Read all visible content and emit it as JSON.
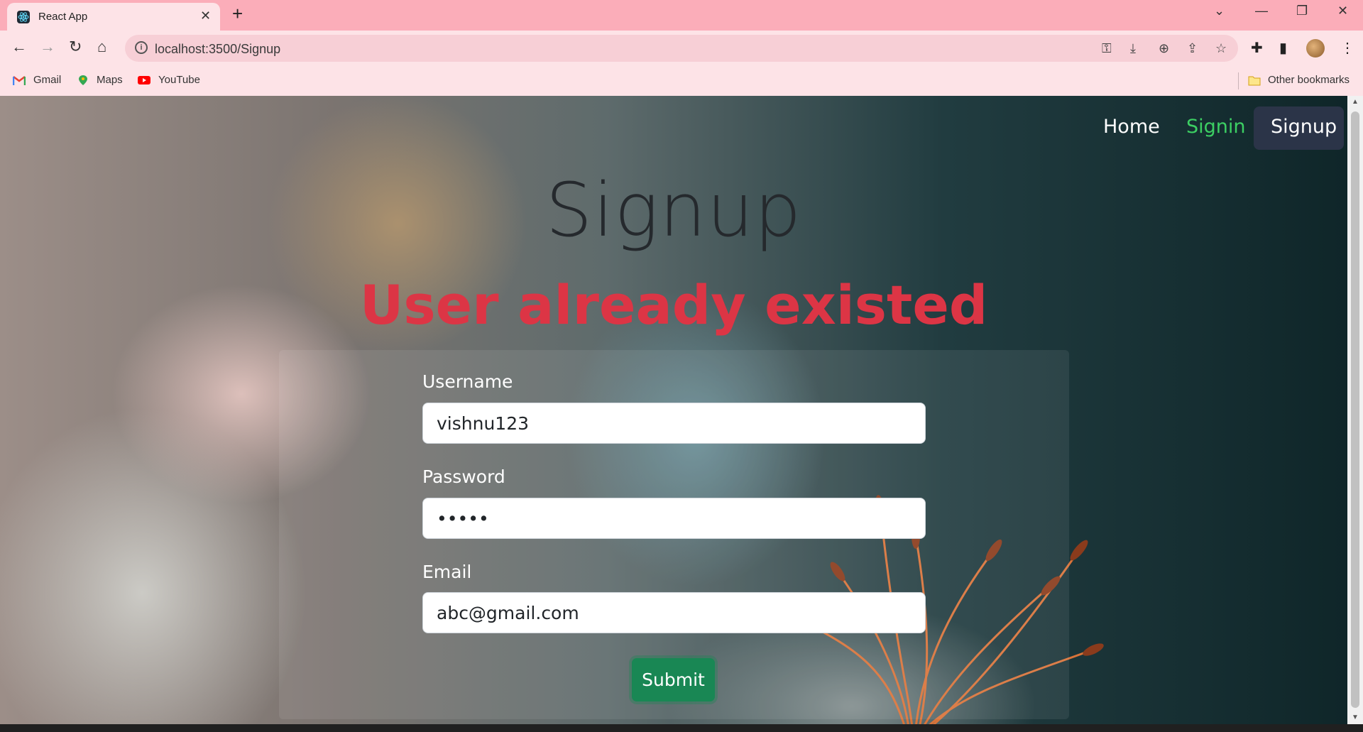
{
  "browser": {
    "tab_title": "React App",
    "tab_close": "✕",
    "new_tab": "+",
    "url": "localhost:3500/Signup",
    "bookmarks": [
      "Gmail",
      "Maps",
      "YouTube"
    ],
    "other_bookmarks": "Other bookmarks",
    "window_controls": {
      "minimize": "—",
      "restore": "❐",
      "close": "✕",
      "tab_search": "⌄"
    }
  },
  "nav": {
    "home": "Home",
    "signin": "Signin",
    "signup": "Signup"
  },
  "page": {
    "title": "Signup",
    "error": "User already existed"
  },
  "form": {
    "username_label": "Username",
    "username_value": "vishnu123",
    "password_label": "Password",
    "password_value": "abcde",
    "email_label": "Email",
    "email_value": "abc@gmail.com",
    "submit_label": "Submit"
  },
  "colors": {
    "tab_bar": "#fbadb9",
    "toolbar": "#fde3e7",
    "nav_active_bg": "#2b3448",
    "signin_link": "#3ccf63",
    "error": "#dc3545",
    "submit": "#198754"
  }
}
